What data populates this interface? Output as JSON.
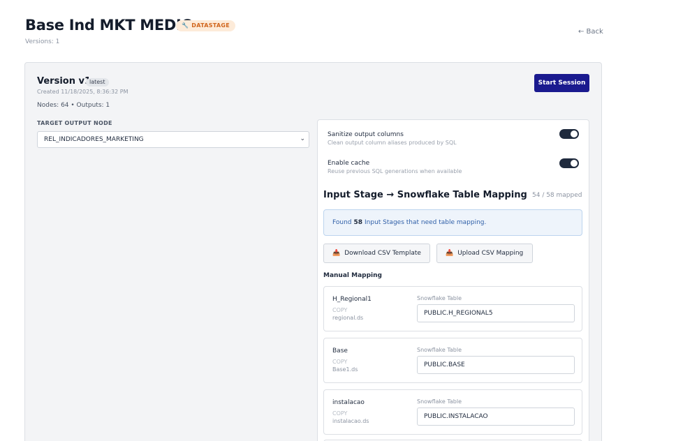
{
  "header": {
    "title": "Base Ind MKT MEDIO",
    "badge": "DATASTAGE",
    "badge_icon": "wrench-icon",
    "versions": "Versions: 1",
    "back": "← Back"
  },
  "version": {
    "title": "Version v1",
    "tag": "latest",
    "created": "Created 11/18/2025, 8:36:32 PM",
    "nodes": "Nodes: 64 • Outputs: 1",
    "start_button": "Start Session"
  },
  "target": {
    "label": "TARGET OUTPUT NODE",
    "selected": "REL_INDICADORES_MARKETING"
  },
  "options": [
    {
      "title": "Sanitize output columns",
      "desc": "Clean output column aliases produced by SQL",
      "enabled": true
    },
    {
      "title": "Enable cache",
      "desc": "Reuse previous SQL generations when available",
      "enabled": true
    }
  ],
  "mapping": {
    "title": "Input Stage → Snowflake Table Mapping",
    "count": "54 / 58 mapped",
    "info_prefix": "Found",
    "info_count": "58",
    "info_suffix": "Input Stages that need table mapping.",
    "download_btn": "Download CSV Template",
    "upload_btn": "Upload CSV Mapping",
    "manual_label": "Manual Mapping",
    "sf_label": "Snowflake Table",
    "rows": [
      {
        "name": "H_Regional1",
        "type": "COPY",
        "file": "regional.ds",
        "table": "PUBLIC.H_REGIONAL5"
      },
      {
        "name": "Base",
        "type": "COPY",
        "file": "Base1.ds",
        "table": "PUBLIC.BASE"
      },
      {
        "name": "instalacao",
        "type": "COPY",
        "file": "instalacao.ds",
        "table": "PUBLIC.INSTALACAO"
      }
    ]
  },
  "colors": {
    "primary": "#1a1a8f",
    "badge_bg": "#fdebd9",
    "badge_fg": "#d0651c",
    "info_bg": "#eef4fb",
    "toggle_on": "#1f2a3d"
  }
}
